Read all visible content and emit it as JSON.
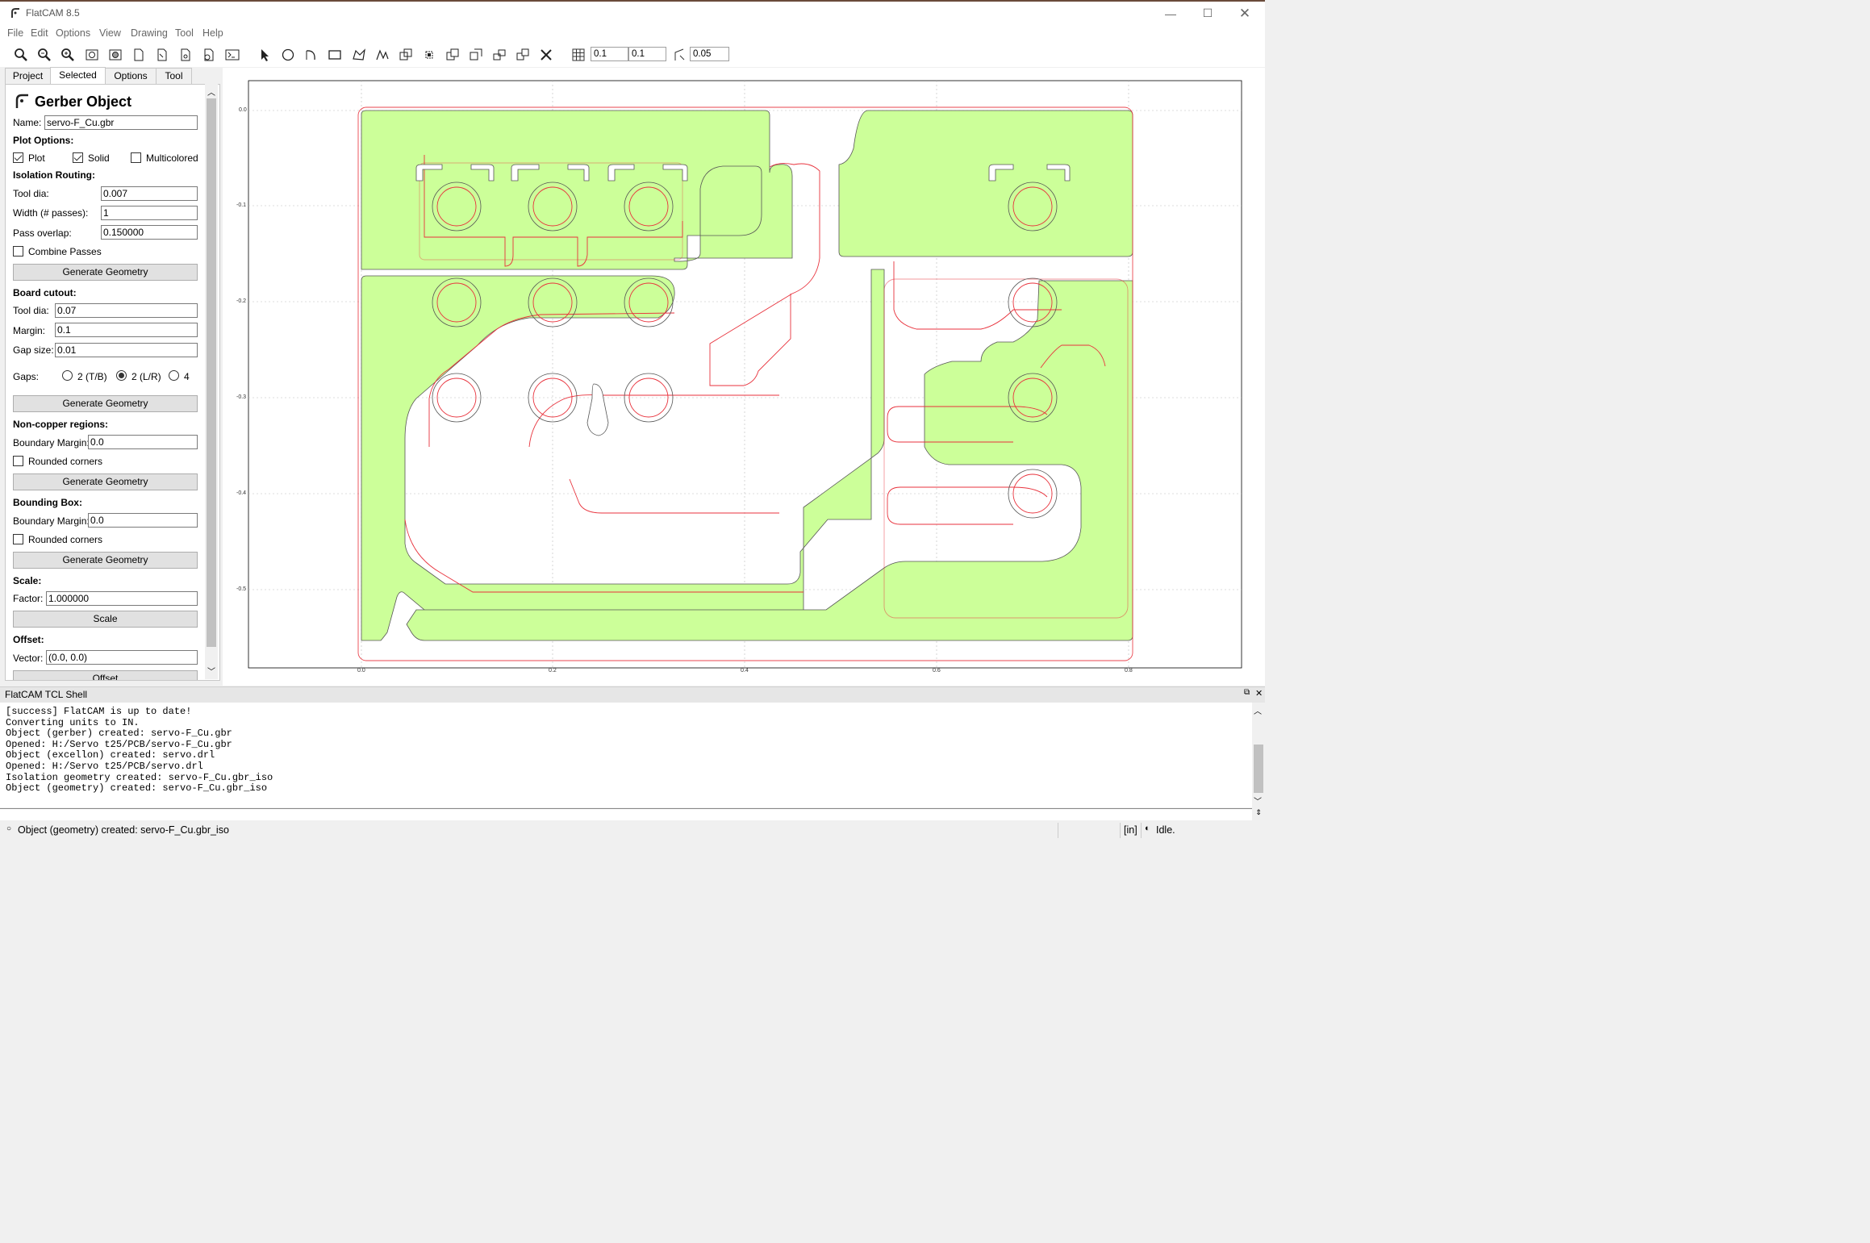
{
  "window": {
    "title": "FlatCAM 8.5"
  },
  "menu": [
    "File",
    "Edit",
    "Options",
    "View",
    "Drawing",
    "Tool",
    "Help"
  ],
  "toolbar": {
    "grid_x": "0.1",
    "grid_y": "0.1",
    "snap_max": "0.05",
    "icons": [
      "zoom-fit-icon",
      "zoom-in-icon",
      "zoom-out-icon",
      "replot-icon",
      "clear-plot-icon",
      "new-project-icon",
      "open-gerber-icon",
      "open-excellon-icon",
      "open-gcode-icon",
      "shell-icon",
      "select-icon",
      "circle-icon",
      "arc-icon",
      "rectangle-icon",
      "polygon-icon",
      "path-icon",
      "union-icon",
      "intersection-icon",
      "subtract-icon",
      "cut-icon",
      "move-icon",
      "copy-icon",
      "delete-icon",
      "grid-snap-icon",
      "corner-snap-icon"
    ]
  },
  "tabs": [
    "Project",
    "Selected",
    "Options",
    "Tool"
  ],
  "panel": {
    "heading": "Gerber Object",
    "name_label": "Name:",
    "name_value": "servo-F_Cu.gbr",
    "plot_options": {
      "title": "Plot Options:",
      "plot": "Plot",
      "solid": "Solid",
      "multicolored": "Multicolored"
    },
    "isolation": {
      "title": "Isolation Routing:",
      "tool_dia_label": "Tool dia:",
      "tool_dia": "0.007",
      "width_label": "Width (# passes):",
      "width": "1",
      "overlap_label": "Pass overlap:",
      "overlap": "0.150000",
      "combine": "Combine Passes",
      "button": "Generate Geometry"
    },
    "cutout": {
      "title": "Board cutout:",
      "tool_dia_label": "Tool dia:",
      "tool_dia": "0.07",
      "margin_label": "Margin:",
      "margin": "0.1",
      "gap_label": "Gap size:",
      "gap": "0.01",
      "gaps_label": "Gaps:",
      "gap_tb": "2 (T/B)",
      "gap_lr": "2 (L/R)",
      "gap_4": "4",
      "button": "Generate Geometry"
    },
    "noncopper": {
      "title": "Non-copper regions:",
      "margin_label": "Boundary Margin:",
      "margin": "0.0",
      "rounded": "Rounded corners",
      "button": "Generate Geometry"
    },
    "bbox": {
      "title": "Bounding Box:",
      "margin_label": "Boundary Margin:",
      "margin": "0.0",
      "rounded": "Rounded corners",
      "button": "Generate Geometry"
    },
    "scale": {
      "title": "Scale:",
      "factor_label": "Factor:",
      "factor": "1.000000",
      "button": "Scale"
    },
    "offset": {
      "title": "Offset:",
      "vector_label": "Vector:",
      "vector": "(0.0, 0.0)",
      "button": "Offset"
    }
  },
  "plot": {
    "x_ticks": [
      "0.0",
      "0.2",
      "0.4",
      "0.6",
      "0.8"
    ],
    "y_ticks": [
      "0.0",
      "-0.1",
      "-0.2",
      "-0.3",
      "-0.4",
      "-0.5"
    ]
  },
  "shell": {
    "title": "FlatCAM TCL Shell",
    "lines": [
      "[success] FlatCAM is up to date!",
      "Converting units to IN.",
      "Object (gerber) created: servo-F_Cu.gbr",
      "Opened: H:/Servo t25/PCB/servo-F_Cu.gbr",
      "Object (excellon) created: servo.drl",
      "Opened: H:/Servo t25/PCB/servo.drl",
      "Isolation geometry created: servo-F_Cu.gbr_iso",
      "Object (geometry) created: servo-F_Cu.gbr_iso"
    ]
  },
  "status": {
    "message": "Object (geometry) created: servo-F_Cu.gbr_iso",
    "units": "[in]",
    "state": "Idle."
  },
  "colors": {
    "copper": "#ccff99",
    "iso": "#e8323c",
    "outline": "#555555"
  }
}
